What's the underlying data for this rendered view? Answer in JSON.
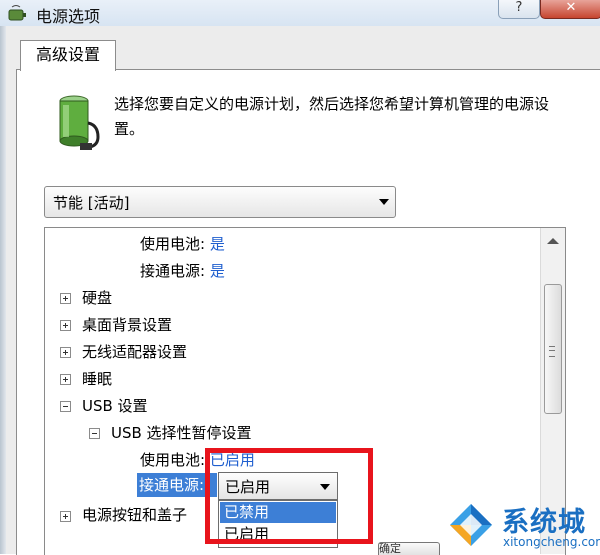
{
  "window": {
    "title": "电源选项",
    "help_label": "?",
    "close_label": "✕"
  },
  "tab": {
    "label": "高级设置"
  },
  "description": "选择您要自定义的电源计划，然后选择您希望计算机管理的电源设置。",
  "plan": {
    "selected": "节能 [活动]"
  },
  "tree": {
    "battery_label": "使用电池:",
    "battery_value": "是",
    "plugged_label": "接通电源:",
    "plugged_value": "是",
    "items": [
      "硬盘",
      "桌面背景设置",
      "无线适配器设置",
      "睡眠"
    ],
    "usb": "USB 设置",
    "usb_suspend": "USB 选择性暂停设置",
    "usb_battery_label": "使用电池:",
    "usb_battery_value": "已启用",
    "usb_plugged_label": "接通电源:",
    "power_buttons": "电源按钮和盖子"
  },
  "dropdown": {
    "selected": "已启用",
    "options": [
      "已禁用",
      "已启用"
    ]
  },
  "ok_button": "确定",
  "watermark": {
    "name": "系统城",
    "url": "xitongcheng.com"
  },
  "colors": {
    "highlight": "#3d7fd6",
    "link_value": "#1f5fcf",
    "annotation_red": "#e8141c",
    "watermark_blue": "#1a6fc2"
  }
}
